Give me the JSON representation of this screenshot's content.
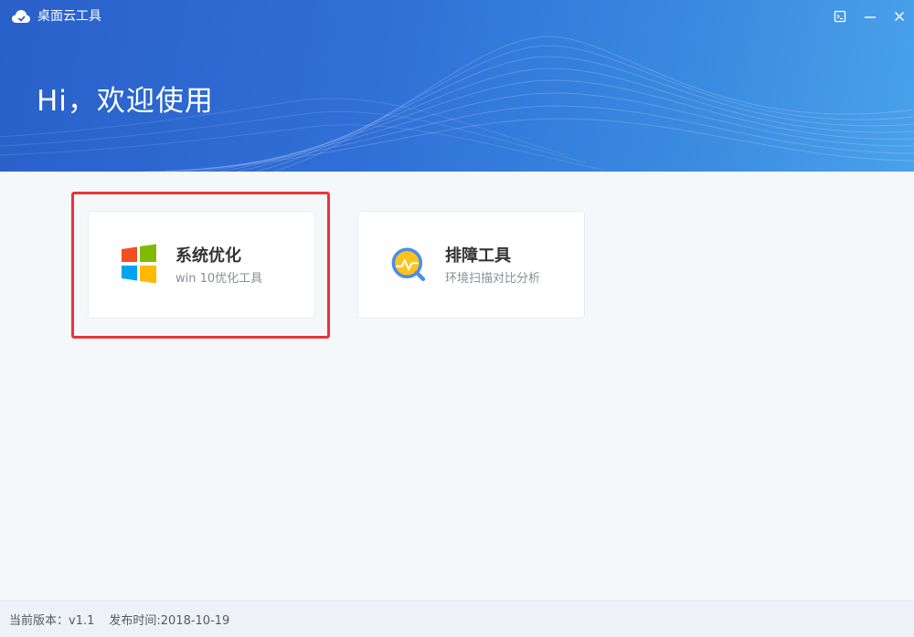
{
  "window": {
    "title": "桌面云工具",
    "controls": {
      "feedback_icon": "feedback-icon",
      "minimize_icon": "minimize-icon",
      "close_icon": "close-icon"
    }
  },
  "header": {
    "greeting": "Hi，欢迎使用"
  },
  "cards": [
    {
      "title": "系统优化",
      "subtitle": "win 10优化工具",
      "icon": "windows-logo-icon"
    },
    {
      "title": "排障工具",
      "subtitle": "环境扫描对比分析",
      "icon": "diagnostic-magnifier-icon"
    }
  ],
  "footer": {
    "version_label": "当前版本：v1.1",
    "release_label": "发布时间:2018-10-19"
  },
  "colors": {
    "header_start": "#2a60c9",
    "header_end": "#4aa2ea",
    "highlight": "#e8353b",
    "win_red": "#f25022",
    "win_green": "#7fba00",
    "win_blue": "#00a4ef",
    "win_yellow": "#ffb900"
  }
}
